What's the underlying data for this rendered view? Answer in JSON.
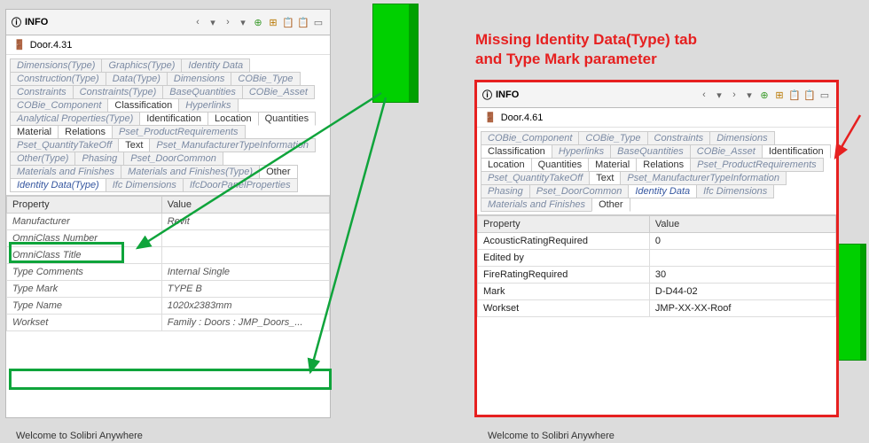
{
  "annotation": "Missing Identity Data(Type) tab\nand Type Mark parameter",
  "left_panel": {
    "title": "INFO",
    "object": "Door.4.31",
    "tabs": [
      "Dimensions(Type)",
      "Graphics(Type)",
      "Identity Data",
      "Construction(Type)",
      "Data(Type)",
      "Dimensions",
      "COBie_Type",
      "Constraints",
      "Constraints(Type)",
      "BaseQuantities",
      "COBie_Asset",
      "COBie_Component",
      "Classification",
      "Hyperlinks",
      "Analytical Properties(Type)",
      "Identification",
      "Location",
      "Quantities",
      "Material",
      "Relations",
      "Pset_ProductRequirements",
      "Pset_QuantityTakeOff",
      "Text",
      "Pset_ManufacturerTypeInformation",
      "Other(Type)",
      "Phasing",
      "Pset_DoorCommon",
      "Materials and Finishes",
      "Materials and Finishes(Type)",
      "Other",
      "Identity Data(Type)",
      "Ifc Dimensions",
      "IfcDoorPanelProperties"
    ],
    "headers": {
      "prop": "Property",
      "val": "Value"
    },
    "rows": [
      {
        "p": "Manufacturer",
        "v": "Revit"
      },
      {
        "p": "OmniClass Number",
        "v": ""
      },
      {
        "p": "OmniClass Title",
        "v": ""
      },
      {
        "p": "Type Comments",
        "v": "Internal Single"
      },
      {
        "p": "Type Mark",
        "v": "TYPE B"
      },
      {
        "p": "Type Name",
        "v": "1020x2383mm"
      },
      {
        "p": "Workset",
        "v": "Family : Doors : JMP_Doors_..."
      }
    ],
    "status": "Welcome to Solibri Anywhere"
  },
  "right_panel": {
    "title": "INFO",
    "object": "Door.4.61",
    "tabs": [
      "COBie_Component",
      "COBie_Type",
      "Constraints",
      "Dimensions",
      "Classification",
      "Hyperlinks",
      "BaseQuantities",
      "COBie_Asset",
      "Identification",
      "Location",
      "Quantities",
      "Material",
      "Relations",
      "Pset_ProductRequirements",
      "Pset_QuantityTakeOff",
      "Text",
      "Pset_ManufacturerTypeInformation",
      "Phasing",
      "Pset_DoorCommon",
      "Identity Data",
      "Ifc Dimensions",
      "Materials and Finishes",
      "Other"
    ],
    "headers": {
      "prop": "Property",
      "val": "Value"
    },
    "rows": [
      {
        "p": "AcousticRatingRequired",
        "v": "0"
      },
      {
        "p": "Edited by",
        "v": ""
      },
      {
        "p": "FireRatingRequired",
        "v": "30"
      },
      {
        "p": "Mark",
        "v": "D-D44-02"
      },
      {
        "p": "Workset",
        "v": "JMP-XX-XX-Roof"
      }
    ],
    "status": "Welcome to Solibri Anywhere"
  }
}
